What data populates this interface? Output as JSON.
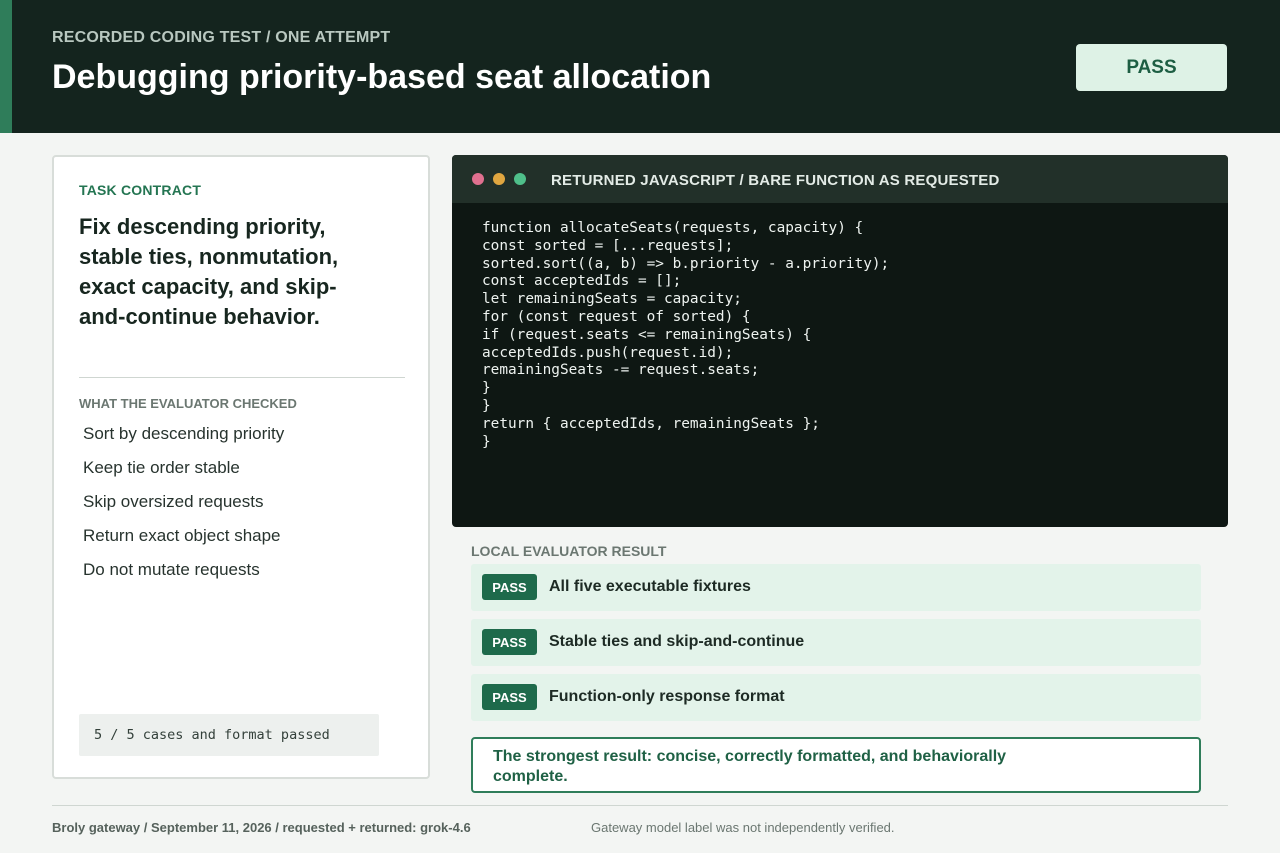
{
  "header": {
    "eyebrow": "RECORDED CODING TEST / ONE ATTEMPT",
    "title": "Debugging priority-based seat allocation",
    "status_badge": "PASS"
  },
  "contract": {
    "eyebrow": "TASK CONTRACT",
    "headline": "Fix descending priority, stable ties, nonmutation, exact capacity, and skip-and-continue behavior.",
    "checked_label": "WHAT THE EVALUATOR CHECKED",
    "checks": [
      "Sort by descending priority",
      "Keep tie order stable",
      "Skip oversized requests",
      "Return exact object shape",
      "Do not mutate requests"
    ],
    "summary": "5 / 5 cases and format passed"
  },
  "code_panel": {
    "title": "RETURNED JAVASCRIPT / BARE FUNCTION AS REQUESTED",
    "code": "function allocateSeats(requests, capacity) {\nconst sorted = [...requests];\nsorted.sort((a, b) => b.priority - a.priority);\nconst acceptedIds = [];\nlet remainingSeats = capacity;\nfor (const request of sorted) {\nif (request.seats <= remainingSeats) {\nacceptedIds.push(request.id);\nremainingSeats -= request.seats;\n}\n}\nreturn { acceptedIds, remainingSeats };\n}"
  },
  "results": {
    "label": "LOCAL EVALUATOR RESULT",
    "rows": [
      {
        "tag": "PASS",
        "text": "All five executable fixtures"
      },
      {
        "tag": "PASS",
        "text": "Stable ties and skip-and-continue"
      },
      {
        "tag": "PASS",
        "text": "Function-only response format"
      }
    ],
    "verdict": "The strongest result: concise, correctly formatted, and behaviorally complete."
  },
  "footer": {
    "left": "Broly gateway / September 11, 2026 / requested + returned: grok-4.6",
    "right": "Gateway model label was not independently verified."
  },
  "colors": {
    "header_bg": "#14241e",
    "accent": "#2f7d5a",
    "pass_bg": "#def2e6",
    "pass_tag": "#1e6a4b",
    "result_row_bg": "#e3f3ea",
    "code_bg": "#0e1713"
  }
}
